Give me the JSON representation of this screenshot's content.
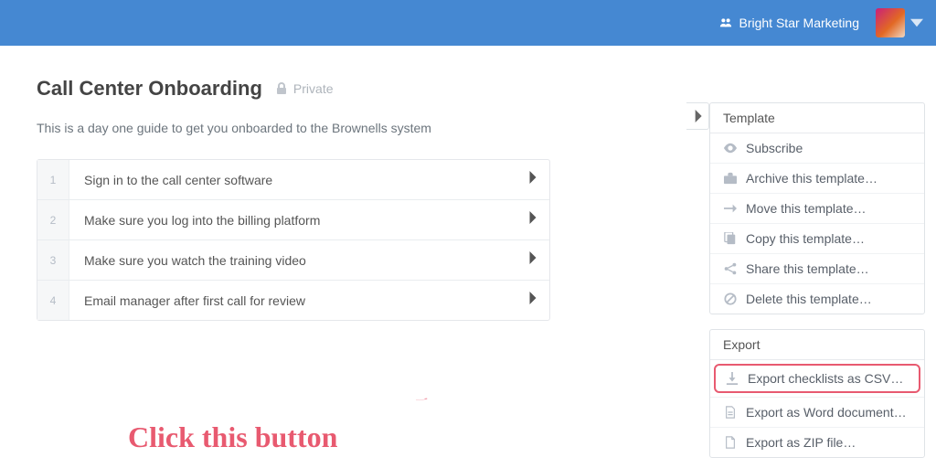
{
  "header": {
    "org_name": "Bright Star Marketing"
  },
  "page": {
    "title": "Call Center Onboarding",
    "privacy": "Private",
    "description": "This is a day one guide to get you onboarded to the Brownells system"
  },
  "steps": [
    {
      "n": "1",
      "label": "Sign in to the call center software"
    },
    {
      "n": "2",
      "label": "Make sure you log into the billing platform"
    },
    {
      "n": "3",
      "label": "Make sure you watch the training video"
    },
    {
      "n": "4",
      "label": "Email manager after first call for review"
    }
  ],
  "annotation": {
    "text": "Click this button"
  },
  "sidebar": {
    "template": {
      "title": "Template",
      "items": [
        {
          "icon": "eye",
          "label": "Subscribe"
        },
        {
          "icon": "briefcase",
          "label": "Archive this template…"
        },
        {
          "icon": "arrow-right",
          "label": "Move this template…"
        },
        {
          "icon": "copy",
          "label": "Copy this template…"
        },
        {
          "icon": "share",
          "label": "Share this template…"
        },
        {
          "icon": "ban",
          "label": "Delete this template…"
        }
      ]
    },
    "export": {
      "title": "Export",
      "items": [
        {
          "icon": "download",
          "label": "Export checklists as CSV…",
          "highlight": true
        },
        {
          "icon": "doc",
          "label": "Export as Word document…"
        },
        {
          "icon": "file",
          "label": "Export as ZIP file…"
        }
      ]
    }
  }
}
